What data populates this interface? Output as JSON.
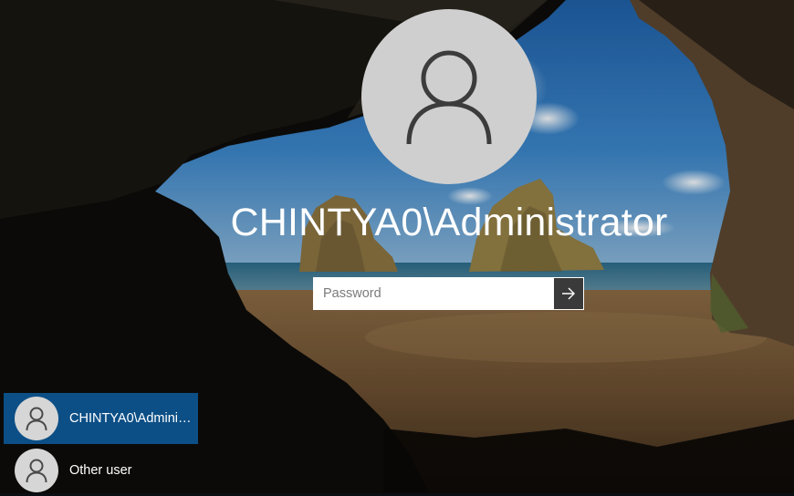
{
  "login": {
    "username": "CHINTYA0\\Administrator",
    "password_placeholder": "Password"
  },
  "user_list": [
    {
      "label": "CHINTYA0\\Administrator",
      "selected": true,
      "icon": "user-icon"
    },
    {
      "label": "Other user",
      "selected": false,
      "icon": "user-icon"
    }
  ],
  "icons": {
    "avatar": "user-icon",
    "submit": "arrow-right-icon"
  },
  "colors": {
    "selected_user_bg": "#0c4f86",
    "avatar_bg": "#cfcfcf",
    "submit_bg": "#3a3a3a"
  }
}
